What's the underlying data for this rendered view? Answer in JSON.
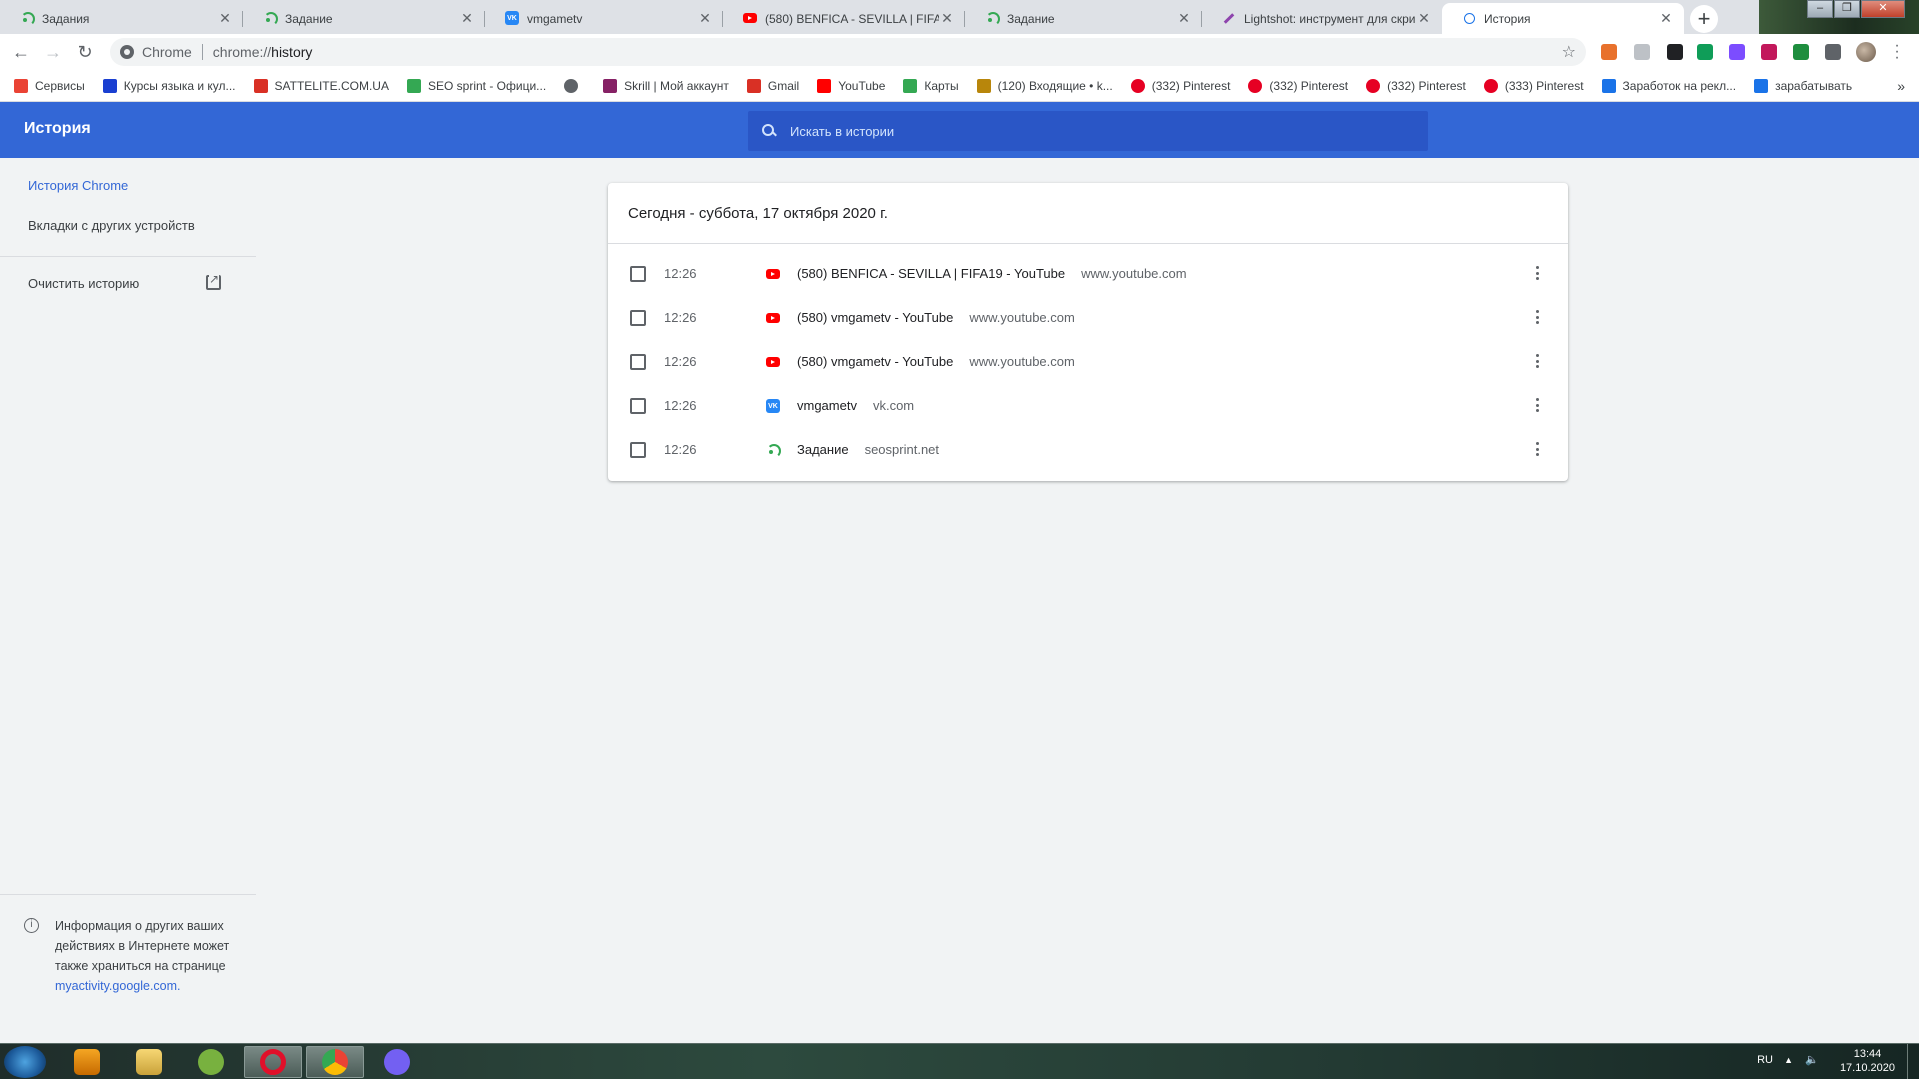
{
  "tabs": [
    {
      "title": "Задания",
      "icon": "seosprint-icon"
    },
    {
      "title": "Задание",
      "icon": "seosprint-icon"
    },
    {
      "title": "vmgametv",
      "icon": "vk-icon"
    },
    {
      "title": "(580) BENFICA - SEVILLA | FIFA19",
      "icon": "youtube-icon"
    },
    {
      "title": "Задание",
      "icon": "seosprint-icon"
    },
    {
      "title": "Lightshot: инструмент для скри",
      "icon": "lightshot-icon"
    },
    {
      "title": "История",
      "icon": "history-icon"
    }
  ],
  "omnibox": {
    "chip": "Chrome",
    "url_prefix": "chrome://",
    "url_host": "history"
  },
  "bookmarks": [
    {
      "label": "Сервисы",
      "icon": "apps-grid-icon",
      "color": "#ea4335"
    },
    {
      "label": "Курсы языка и кул...",
      "icon": "b-icon",
      "color": "#1a3fd1"
    },
    {
      "label": "SATTELITE.COM.UA",
      "icon": "a-icon",
      "color": "#d93025"
    },
    {
      "label": "SEO sprint - Офици...",
      "icon": "seosprint-icon",
      "color": "#34a853"
    },
    {
      "label": "",
      "icon": "globe-icon",
      "color": "#5f6368"
    },
    {
      "label": "Skrill | Мой аккаунт",
      "icon": "skrill-icon",
      "color": "#862165"
    },
    {
      "label": "Gmail",
      "icon": "gmail-icon",
      "color": "#d93025"
    },
    {
      "label": "YouTube",
      "icon": "youtube-icon",
      "color": "#ff0000"
    },
    {
      "label": "Карты",
      "icon": "maps-pin-icon",
      "color": "#34a853"
    },
    {
      "label": "(120) Входящие • k...",
      "icon": "mail-icon",
      "color": "#b8860b"
    },
    {
      "label": "(332) Pinterest",
      "icon": "pinterest-icon",
      "color": "#e60023"
    },
    {
      "label": "(332) Pinterest",
      "icon": "pinterest-icon",
      "color": "#e60023"
    },
    {
      "label": "(332) Pinterest",
      "icon": "pinterest-icon",
      "color": "#e60023"
    },
    {
      "label": "(333) Pinterest",
      "icon": "pinterest-icon",
      "color": "#e60023"
    },
    {
      "label": "Заработок на рекл...",
      "icon": "wifi-icon",
      "color": "#1a73e8"
    },
    {
      "label": "зарабатывать",
      "icon": "ad-icon",
      "color": "#1a73e8"
    }
  ],
  "header": {
    "title": "История",
    "search_placeholder": "Искать в истории"
  },
  "sidebar": {
    "items": [
      {
        "label": "История Chrome"
      },
      {
        "label": "Вкладки с других устройств"
      }
    ],
    "clear_label": "Очистить историю",
    "footer_text": "Информация о других ваших действиях в Интернете может также храниться на странице",
    "footer_link": "myactivity.google.com."
  },
  "card": {
    "date_title": "Сегодня - суббота, 17 октября 2020 г.",
    "entries": [
      {
        "time": "12:26",
        "title": "(580) BENFICA - SEVILLA | FIFA19 - YouTube",
        "domain": "www.youtube.com",
        "icon": "youtube-icon"
      },
      {
        "time": "12:26",
        "title": "(580) vmgametv - YouTube",
        "domain": "www.youtube.com",
        "icon": "youtube-icon"
      },
      {
        "time": "12:26",
        "title": "(580) vmgametv - YouTube",
        "domain": "www.youtube.com",
        "icon": "youtube-icon"
      },
      {
        "time": "12:26",
        "title": "vmgametv",
        "domain": "vk.com",
        "icon": "vk-icon"
      },
      {
        "time": "12:26",
        "title": "Задание",
        "domain": "seosprint.net",
        "icon": "seosprint-icon"
      }
    ]
  },
  "taskbar": {
    "lang": "RU",
    "time": "13:44",
    "date": "17.10.2020"
  },
  "colors": {
    "header_blue": "#3367d6",
    "accent": "#3367d6",
    "youtube_red": "#ff0000",
    "vk_blue": "#2787f5",
    "seosprint_green": "#34a853"
  }
}
